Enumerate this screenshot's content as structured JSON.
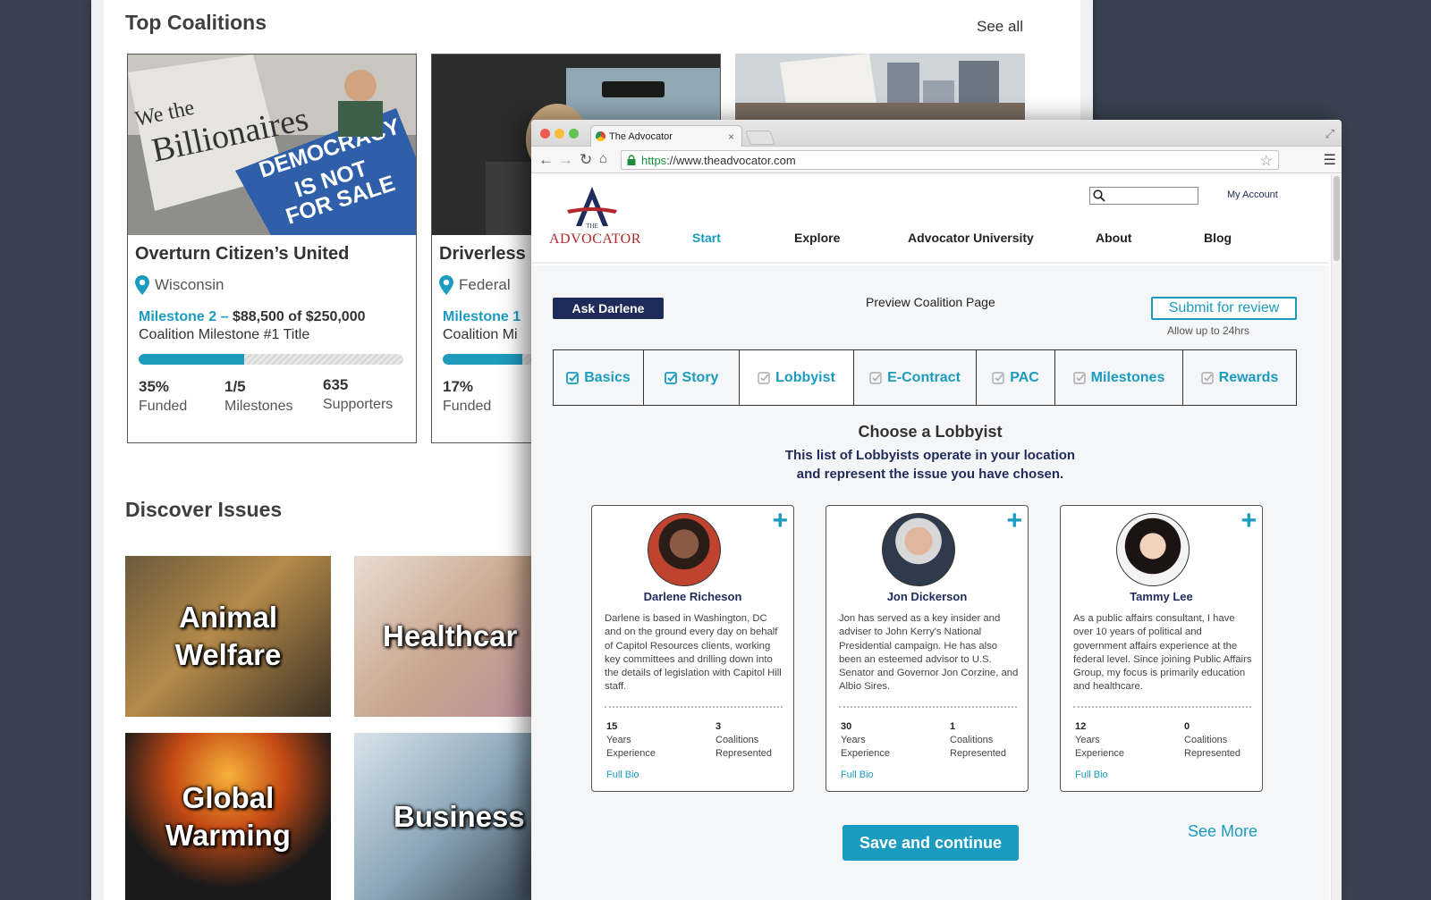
{
  "background_page": {
    "top_coalitions_title": "Top Coalitions",
    "see_all": "See all",
    "coalitions": [
      {
        "title": "Overturn Citizen’s United",
        "location": "Wisconsin",
        "milestone_name": "Milestone 2 –",
        "milestone_amount": "$88,500 of $250,000",
        "milestone_title": "Coalition Milestone #1 Title",
        "progress": 0.4,
        "funded_value": "35%",
        "funded_label": "Funded",
        "milestones_value": "1/5",
        "milestones_label": "Milestones",
        "supporters_value": "635",
        "supporters_label": "Supporters",
        "image_text": [
          "DEMOCRACY",
          "IS NOT",
          "FOR SALE"
        ]
      },
      {
        "title": "Driverless",
        "location": "Federal",
        "milestone_name": "Milestone 1",
        "milestone_title": "Coalition Mi",
        "progress": 0.3,
        "funded_value": "17%",
        "funded_label": "Funded"
      }
    ],
    "discover_title": "Discover Issues",
    "issues": [
      {
        "line1": "Animal",
        "line2": "Welfare"
      },
      {
        "line1": "Healthcar",
        "line2": ""
      },
      {
        "line1": "Global",
        "line2": "Warming"
      },
      {
        "line1": "Business",
        "line2": ""
      }
    ]
  },
  "browser": {
    "tab_title": "The Advocator",
    "tab_close": "×",
    "url_scheme": "https",
    "url_rest": "://www.theadvocator.com"
  },
  "site": {
    "logo_the": "THE",
    "logo_name": "ADVOCATOR",
    "account_link": "My Account",
    "nav": [
      "Start",
      "Explore",
      "Advocator University",
      "About",
      "Blog"
    ],
    "ask_button": "Ask Darlene",
    "preview_link": "Preview Coalition Page",
    "submit_button": "Submit for review",
    "allow_text": "Allow up to 24hrs",
    "steps": [
      "Basics",
      "Story",
      "Lobbyist",
      "E-Contract",
      "PAC",
      "Milestones",
      "Rewards"
    ],
    "choose_title": "Choose a Lobbyist",
    "choose_sub_1": "This list of Lobbyists operate in your location",
    "choose_sub_2": "and represent the issue you have chosen.",
    "lobbyists": [
      {
        "name": "Darlene Richeson",
        "bio": "Darlene is based in Washington, DC and on the ground every day on behalf of Capitol Resources clients, working key committees and drilling down into the details of legislation with Capitol Hill staff.",
        "years": "15",
        "coalitions": "3"
      },
      {
        "name": "Jon Dickerson",
        "bio": "Jon has served as a key insider and adviser to John Kerry's National Presidential campaign. He has also been an esteemed advisor to U.S. Senator and Governor Jon Corzine, and Albio Sires.",
        "years": "30",
        "coalitions": "1"
      },
      {
        "name": "Tammy Lee",
        "bio": "As a public affairs consultant, I have over 10 years of political and government affairs experience at the federal level. Since joining Public Affairs Group, my focus is primarily education and healthcare.",
        "years": "12",
        "coalitions": "0"
      }
    ],
    "years_label_1": "Years",
    "years_label_2": "Experience",
    "coal_label_1": "Coalitions",
    "coal_label_2": "Represented",
    "full_bio": "Full Bio",
    "plus": "+",
    "save_button": "Save and continue",
    "see_more": "See More"
  },
  "colors": {
    "accent": "#1a9bbf",
    "navy": "#1f2b5b",
    "logo_red": "#b3282d",
    "backdrop": "#3a4150"
  }
}
